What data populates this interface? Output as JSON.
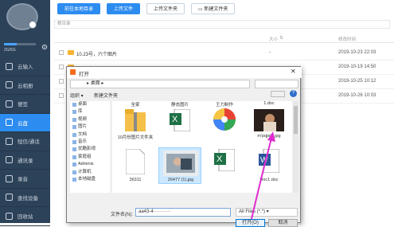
{
  "sidebar": {
    "storage_text": "2G/5G",
    "storage_fraction": 0.4,
    "items": [
      {
        "label": "云输入",
        "active": false
      },
      {
        "label": "云相册",
        "active": false
      },
      {
        "label": "便签",
        "active": false
      },
      {
        "label": "云盘",
        "active": true
      },
      {
        "label": "短信/通话",
        "active": false
      },
      {
        "label": "通讯录",
        "active": false
      },
      {
        "label": "录音",
        "active": false
      },
      {
        "label": "查找设备",
        "active": false
      },
      {
        "label": "回收站",
        "active": false
      }
    ]
  },
  "toolbar": {
    "local_dir": "前往本地目录",
    "upload_file": "上传文件",
    "upload_folder": "上传文件夹",
    "new_folder": "新建文件夹"
  },
  "path": {
    "root": "根目录"
  },
  "table": {
    "col_size": "大小",
    "col_time": "修改时间",
    "rows": [
      {
        "name": "10.23号，六个图片",
        "size": "-",
        "time": "2019-10-23 22:03"
      },
      {
        "name": "",
        "size": "-",
        "time": "2019-10-19 14:50"
      },
      {
        "name": "",
        "size": "-",
        "time": "2019-10-25 10:12"
      },
      {
        "name": "",
        "size": "-",
        "time": "2019-10-26 10:03"
      }
    ]
  },
  "dialog": {
    "title": "打开",
    "address": "桌面",
    "close": "✕",
    "organize": "组织 ▾",
    "new_folder": "新建文件夹",
    "help": "?",
    "tree": [
      "桌面",
      "库",
      "视频",
      "图片",
      "文档",
      "音乐",
      "优酷影视",
      "家庭组",
      "Adminis",
      "计算机",
      "本地磁盘"
    ],
    "files": [
      {
        "label": "全家",
        "kind": "folder"
      },
      {
        "label": "静态图片",
        "kind": "excel"
      },
      {
        "label": "王力制作",
        "kind": "pinwheel"
      },
      {
        "label": "1.doc",
        "kind": "word-photo"
      },
      {
        "label": "10月份图片文件夹",
        "kind": "zip"
      },
      {
        "label": "",
        "kind": "excel2"
      },
      {
        "label": "",
        "kind": "pinwheel2"
      },
      {
        "label": "m'pqjehj.jpg",
        "kind": "photo"
      },
      {
        "label": "36311",
        "kind": "blank"
      },
      {
        "label": "26477 (1).jpg",
        "kind": "photo-selected"
      },
      {
        "label": "",
        "kind": "excel3"
      },
      {
        "label": "Doc1.doc",
        "kind": "word"
      }
    ],
    "filename_label": "文件名(N):",
    "filename_value": "aa43-4···········",
    "filetype": "All Files (*.*)",
    "open_button": "打开(O)",
    "cancel_button": "取消"
  },
  "colors": {
    "accent": "#2d8cf0",
    "sidebar": "#2c4259",
    "arrow": "#e02bd0"
  }
}
